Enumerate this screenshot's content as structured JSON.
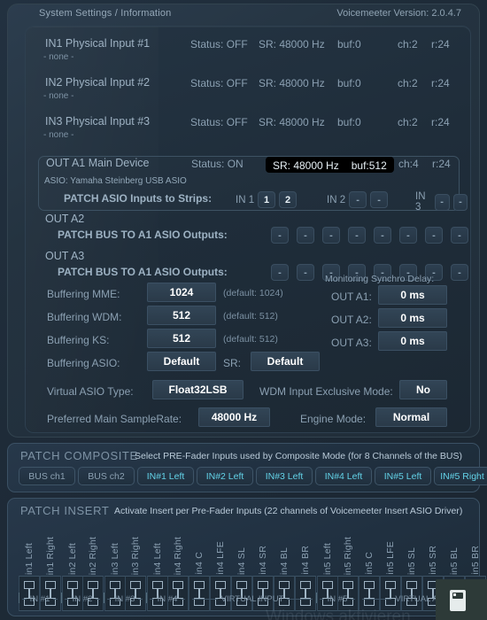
{
  "header": {
    "title": "System Settings / Information",
    "version_label": "Voicemeeter Version: 2.0.4.7"
  },
  "devices": [
    {
      "name": "IN1 Physical Input #1",
      "sub": "- none -",
      "status": "Status: OFF",
      "sr": "SR: 48000 Hz",
      "buf": "buf:0",
      "ch": "ch:2",
      "r": "r:24"
    },
    {
      "name": "IN2 Physical Input #2",
      "sub": "- none -",
      "status": "Status: OFF",
      "sr": "SR: 48000 Hz",
      "buf": "buf:0",
      "ch": "ch:2",
      "r": "r:24"
    },
    {
      "name": "IN3 Physical Input #3",
      "sub": "- none -",
      "status": "Status: OFF",
      "sr": "SR: 48000 Hz",
      "buf": "buf:0",
      "ch": "ch:2",
      "r": "r:24"
    }
  ],
  "out_a1": {
    "name": "OUT A1 Main Device",
    "status": "Status: ON",
    "sr": "SR: 48000 Hz",
    "buf": "buf:512",
    "ch": "ch:4",
    "r": "r:24",
    "driver": "ASIO: Yamaha Steinberg USB ASIO",
    "patch_label": "PATCH ASIO Inputs to Strips:",
    "groups": [
      {
        "label": "IN 1",
        "buttons": [
          "1",
          "2"
        ],
        "active": [
          true,
          true
        ]
      },
      {
        "label": "IN 2",
        "buttons": [
          "-",
          "-"
        ],
        "active": [
          false,
          false
        ]
      },
      {
        "label": "IN 3",
        "buttons": [
          "-",
          "-"
        ],
        "active": [
          false,
          false
        ]
      }
    ]
  },
  "out_a2": {
    "name": "OUT A2",
    "patch_label": "PATCH BUS TO A1 ASIO Outputs:",
    "buttons": [
      "-",
      "-",
      "-",
      "-",
      "-",
      "-",
      "-",
      "-"
    ]
  },
  "out_a3": {
    "name": "OUT A3",
    "patch_label": "PATCH BUS TO A1 ASIO Outputs:",
    "buttons": [
      "-",
      "-",
      "-",
      "-",
      "-",
      "-",
      "-",
      "-"
    ]
  },
  "buffering": {
    "rows": [
      {
        "label": "Buffering MME:",
        "value": "1024",
        "note": "(default: 1024)"
      },
      {
        "label": "Buffering WDM:",
        "value": "512",
        "note": "(default: 512)"
      },
      {
        "label": "Buffering KS:",
        "value": "512",
        "note": "(default: 512)"
      },
      {
        "label": "Buffering ASIO:",
        "value": "Default",
        "note": ""
      }
    ],
    "sr_label": "SR:",
    "sr_value": "Default"
  },
  "monitoring": {
    "title": "Monitoring Synchro Delay:",
    "rows": [
      {
        "label": "OUT A1:",
        "value": "0 ms"
      },
      {
        "label": "OUT A2:",
        "value": "0 ms"
      },
      {
        "label": "OUT A3:",
        "value": "0 ms"
      }
    ]
  },
  "options": {
    "virtual_asio_label": "Virtual ASIO Type:",
    "virtual_asio_value": "Float32LSB",
    "wdm_label": "WDM Input Exclusive Mode:",
    "wdm_value": "No",
    "samplerate_label": "Preferred Main SampleRate:",
    "samplerate_value": "48000 Hz",
    "engine_label": "Engine Mode:",
    "engine_value": "Normal"
  },
  "patch_composite": {
    "title": "PATCH COMPOSITE",
    "subtitle": "Select PRE-Fader Inputs used by Composite Mode (for 8 Channels of the BUS)",
    "buttons": [
      {
        "label": "BUS ch1",
        "on": false
      },
      {
        "label": "BUS ch2",
        "on": false
      },
      {
        "label": "IN#1 Left",
        "on": true
      },
      {
        "label": "IN#2 Left",
        "on": true
      },
      {
        "label": "IN#3 Left",
        "on": true
      },
      {
        "label": "IN#4 Left",
        "on": true
      },
      {
        "label": "IN#5 Left",
        "on": true
      },
      {
        "label": "IN#5 Right",
        "on": true
      }
    ]
  },
  "patch_insert": {
    "title": "PATCH INSERT",
    "subtitle": "Activate Insert per Pre-Fader Inputs (22 channels of Voicemeeter Insert ASIO Driver)",
    "channels": [
      "in1 Left",
      "in1 Right",
      "in2 Left",
      "in2 Right",
      "in3 Left",
      "in3 Right",
      "in4 Left",
      "in4 Right",
      "in4 C",
      "in4 LFE",
      "in4 SL",
      "in4 SR",
      "in4 BL",
      "in4 BR",
      "in5 Left",
      "in5 Right",
      "in5 C",
      "in5 LFE",
      "in5 SL",
      "in5 SR",
      "in5 BL",
      "in5 BR"
    ],
    "separators_before": [
      2,
      4,
      6,
      14
    ],
    "groups": [
      {
        "label": "IN #1",
        "start": 0,
        "span": 2
      },
      {
        "label": "IN #2",
        "start": 2,
        "span": 2
      },
      {
        "label": "IN #3",
        "start": 4,
        "span": 2
      },
      {
        "label": "IN #4",
        "start": 6,
        "span": 2
      },
      {
        "label": "VIRTUAL INPUT",
        "start": 8,
        "span": 6
      },
      {
        "label": "IN #5",
        "start": 14,
        "span": 2
      },
      {
        "label": "VIRTUAL AUX",
        "start": 16,
        "span": 6
      }
    ],
    "group_dividers": [
      0,
      2,
      4,
      6,
      14
    ],
    "insert_states": [
      false,
      false,
      false,
      false,
      false,
      false,
      false,
      false,
      false,
      false,
      false,
      false,
      false,
      false,
      false,
      false,
      false,
      false,
      false,
      false,
      false,
      false
    ]
  },
  "watermark": "Windows aktivieren",
  "colors": {
    "accent_cyan": "#63d2e8",
    "text_dim": "#8ba0b2",
    "panel_bg": "#203040",
    "value_bg": "#324556"
  }
}
